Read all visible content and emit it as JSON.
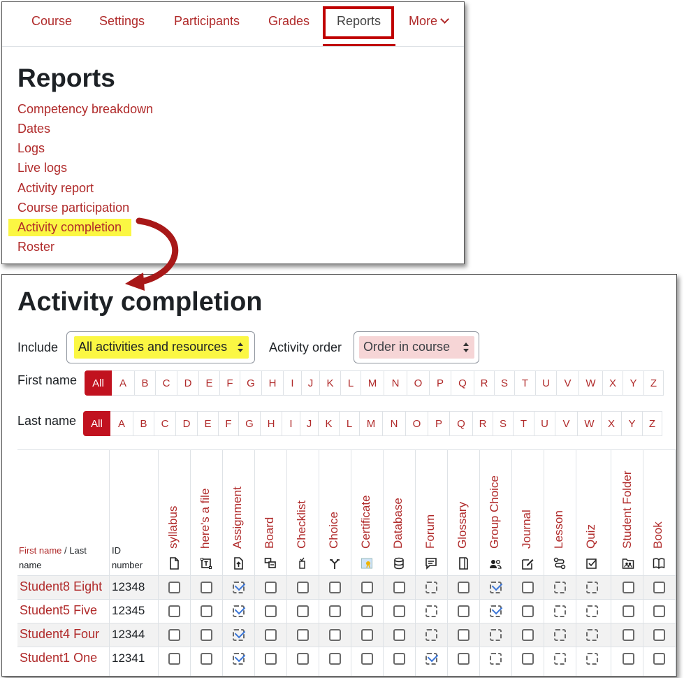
{
  "nav": {
    "items": [
      {
        "label": "Course"
      },
      {
        "label": "Settings"
      },
      {
        "label": "Participants"
      },
      {
        "label": "Grades"
      },
      {
        "label": "Reports"
      },
      {
        "label": "More"
      }
    ],
    "active": "Reports"
  },
  "reports": {
    "title": "Reports",
    "links": [
      "Competency breakdown",
      "Dates",
      "Logs",
      "Live logs",
      "Activity report",
      "Course participation",
      "Activity completion",
      "Roster"
    ],
    "highlighted": "Activity completion",
    "highlight_color": "#fbf743",
    "annotation_color": "#c00000"
  },
  "completion": {
    "title": "Activity completion",
    "include_label": "Include",
    "include_value": "All activities and resources",
    "order_label": "Activity order",
    "order_value": "Order in course",
    "first_name_label": "First name",
    "last_name_label": "Last name",
    "letters": [
      "All",
      "A",
      "B",
      "C",
      "D",
      "E",
      "F",
      "G",
      "H",
      "I",
      "J",
      "K",
      "L",
      "M",
      "N",
      "O",
      "P",
      "Q",
      "R",
      "S",
      "T",
      "U",
      "V",
      "W",
      "X",
      "Y",
      "Z"
    ],
    "header_first": "First name",
    "header_slash": " / Last",
    "header_name": "name",
    "header_id1": "ID",
    "header_id2": "number",
    "activities": [
      {
        "name": "syllabus",
        "icon": "file-icon",
        "tracking": "manual"
      },
      {
        "name": "here's a file",
        "icon": "text-box-icon",
        "tracking": "manual"
      },
      {
        "name": "Assignment",
        "icon": "assignment-upload-icon",
        "tracking": "auto"
      },
      {
        "name": "Board",
        "icon": "board-icon",
        "tracking": "manual"
      },
      {
        "name": "Checklist",
        "icon": "checklist-icon",
        "tracking": "manual"
      },
      {
        "name": "Choice",
        "icon": "choice-icon",
        "tracking": "manual"
      },
      {
        "name": "Certificate",
        "icon": "certificate-icon",
        "tracking": "manual"
      },
      {
        "name": "Database",
        "icon": "database-icon",
        "tracking": "manual"
      },
      {
        "name": "Forum",
        "icon": "forum-icon",
        "tracking": "auto"
      },
      {
        "name": "Glossary",
        "icon": "glossary-icon",
        "tracking": "manual"
      },
      {
        "name": "Group Choice",
        "icon": "group-choice-icon",
        "tracking": "auto"
      },
      {
        "name": "Journal",
        "icon": "journal-icon",
        "tracking": "manual"
      },
      {
        "name": "Lesson",
        "icon": "lesson-icon",
        "tracking": "auto"
      },
      {
        "name": "Quiz",
        "icon": "quiz-icon",
        "tracking": "auto"
      },
      {
        "name": "Student Folder",
        "icon": "student-folder-icon",
        "tracking": "manual"
      },
      {
        "name": "Book",
        "icon": "book-icon",
        "tracking": "manual"
      }
    ],
    "students": [
      {
        "name": "Student8 Eight",
        "id": "12348",
        "completed": [
          2,
          10
        ]
      },
      {
        "name": "Student5 Five",
        "id": "12345",
        "completed": [
          2,
          10
        ]
      },
      {
        "name": "Student4 Four",
        "id": "12344",
        "completed": [
          2
        ]
      },
      {
        "name": "Student1 One",
        "id": "12341",
        "completed": [
          2,
          8
        ]
      }
    ],
    "include_highlight": "#fbf743",
    "order_highlight": "#f6d5d6",
    "check_color": "#3a75d6"
  }
}
